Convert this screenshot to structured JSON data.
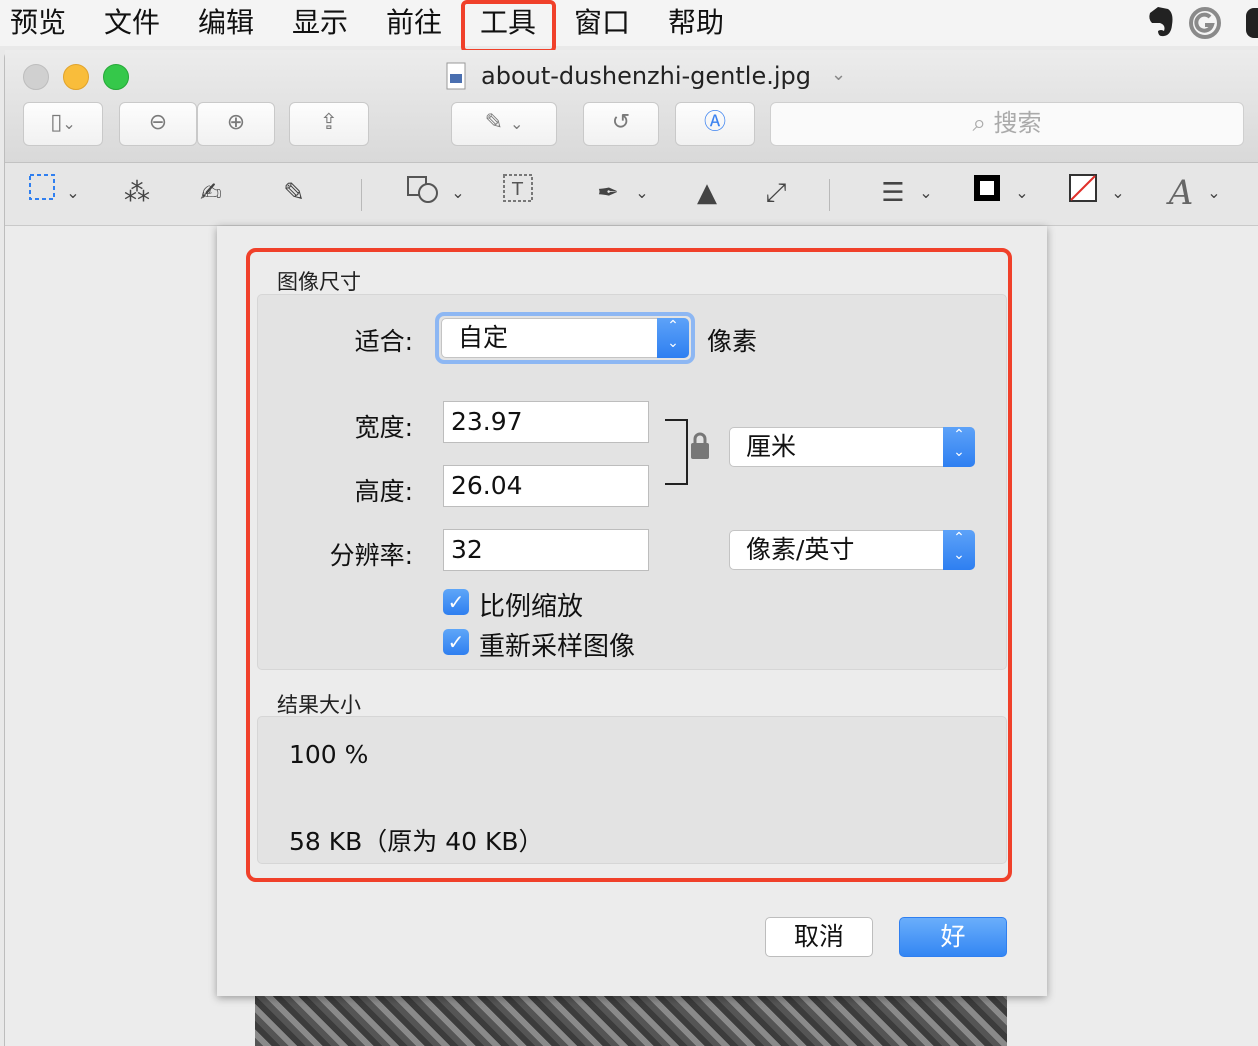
{
  "menubar": {
    "items": [
      "预览",
      "文件",
      "编辑",
      "显示",
      "前往",
      "工具",
      "窗口",
      "帮助"
    ],
    "highlighted": "工具",
    "right_icons": [
      "evernote-icon",
      "grammarly-icon"
    ]
  },
  "window": {
    "title": "about-dushenzhi-gentle.jpg",
    "search_placeholder": "搜索"
  },
  "dialog": {
    "section_image_size": "图像尺寸",
    "fit_label": "适合:",
    "fit_value": "自定",
    "fit_unit": "像素",
    "width_label": "宽度:",
    "width_value": "23.97",
    "height_label": "高度:",
    "height_value": "26.04",
    "unit_value": "厘米",
    "resolution_label": "分辨率:",
    "resolution_value": "32",
    "resolution_unit": "像素/英寸",
    "scale_proportionally": "比例缩放",
    "resample_image": "重新采样图像",
    "section_result_size": "结果大小",
    "result_percent": "100 %",
    "result_size": "58 KB（原为 40 KB）",
    "cancel_label": "取消",
    "ok_label": "好"
  },
  "colors": {
    "highlight": "#f0402a",
    "accent": "#2f7ff0"
  }
}
